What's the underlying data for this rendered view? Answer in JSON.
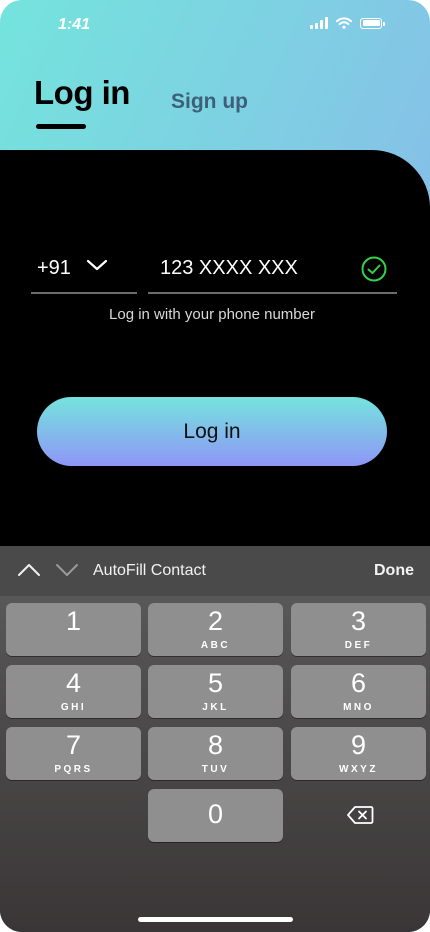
{
  "status": {
    "time": "1:41"
  },
  "tabs": {
    "login": "Log in",
    "signup": "Sign up"
  },
  "form": {
    "country_code": "+91",
    "phone_value": "123 XXXX XXX",
    "hint": "Log in with your phone number",
    "login_button": "Log in"
  },
  "keyboard": {
    "autofill": "AutoFill Contact",
    "done": "Done",
    "keys": [
      {
        "digit": "1",
        "letters": ""
      },
      {
        "digit": "2",
        "letters": "ABC"
      },
      {
        "digit": "3",
        "letters": "DEF"
      },
      {
        "digit": "4",
        "letters": "GHI"
      },
      {
        "digit": "5",
        "letters": "JKL"
      },
      {
        "digit": "6",
        "letters": "MNO"
      },
      {
        "digit": "7",
        "letters": "PQRS"
      },
      {
        "digit": "8",
        "letters": "TUV"
      },
      {
        "digit": "9",
        "letters": "WXYZ"
      },
      {
        "digit": "0",
        "letters": ""
      }
    ]
  },
  "colors": {
    "gradient_start": "#74e4dd",
    "gradient_end": "#8f96f7",
    "valid_check": "#35d04a",
    "signup_tab": "#3e5f7a"
  }
}
